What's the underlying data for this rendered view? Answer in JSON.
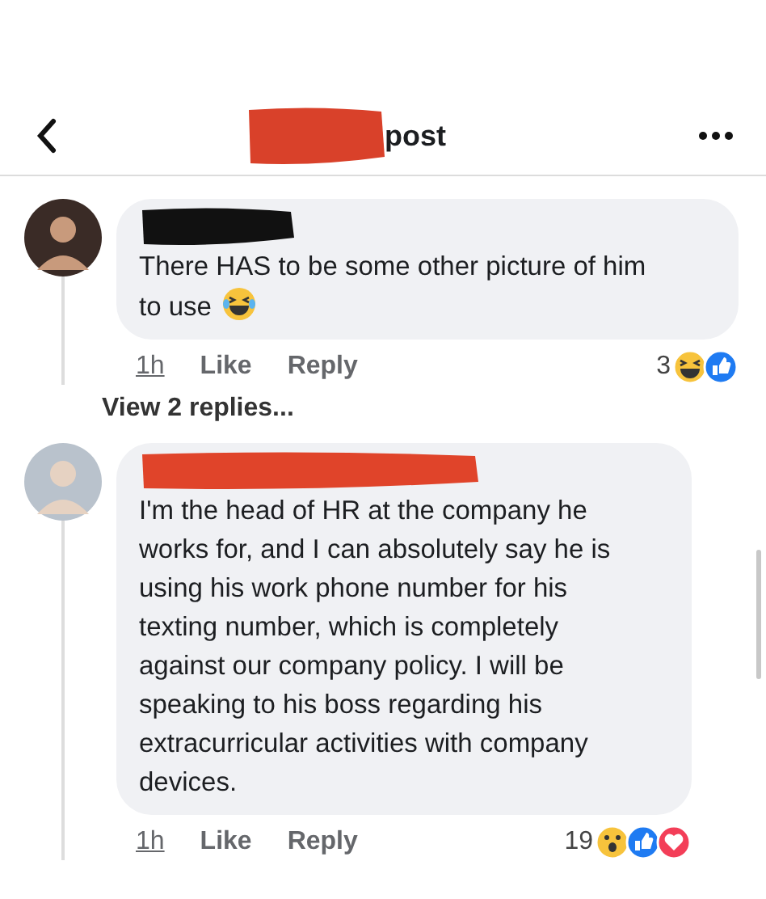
{
  "header": {
    "title": "post"
  },
  "comments": [
    {
      "body": "There HAS to be some other picture of him\nto use",
      "inline_icons": [
        {
          "kind": "laughing"
        }
      ],
      "time": "1h",
      "like": "Like",
      "reply": "Reply",
      "reaction_count": "3",
      "reactions": [
        {
          "kind": "haha"
        },
        {
          "kind": "like"
        }
      ],
      "replies_link": "View 2 replies..."
    },
    {
      "body": "I'm the head of HR at the company he\nworks for, and I can absolutely say he is\nusing his work phone number for his\ntexting number, which is completely\nagainst our company policy.  I will be\nspeaking to his boss regarding his\nextracurricular activities with company\ndevices.",
      "time": "1h",
      "like": "Like",
      "reply": "Reply",
      "reaction_count": "19",
      "reactions": [
        {
          "kind": "wow"
        },
        {
          "kind": "like"
        },
        {
          "kind": "love"
        }
      ]
    }
  ]
}
